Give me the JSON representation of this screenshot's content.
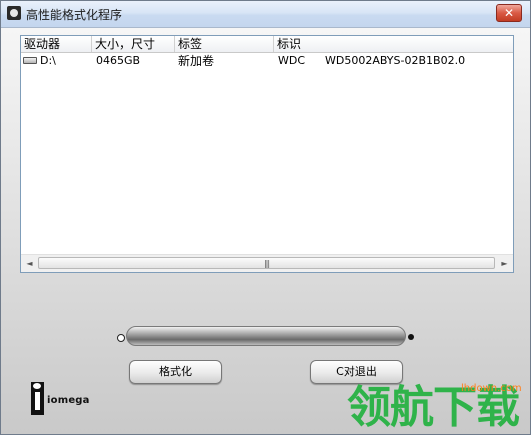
{
  "window": {
    "title": "高性能格式化程序",
    "close_glyph": "✕"
  },
  "listview": {
    "columns": [
      "驱动器",
      "大小，尺寸",
      "标签",
      "标识"
    ],
    "rows": [
      {
        "drive": "D:\\",
        "size": "0465GB",
        "label": "新加卷",
        "vendor": "WDC",
        "model": "WD5002ABYS-02B1B02.0"
      }
    ],
    "scrollbar": {
      "left_arrow": "◄",
      "right_arrow": "►",
      "grip": "|||"
    }
  },
  "progress": {
    "value": 0
  },
  "buttons": {
    "format": "格式化",
    "exit": "C对退出"
  },
  "logo": {
    "text": "iomega"
  },
  "watermark": {
    "domain": "lhdown.com",
    "text": "领航下载"
  },
  "colors": {
    "watermark_green": "#2fb34a",
    "watermark_orange": "#ff7f1a",
    "close_red": "#c23c24"
  }
}
